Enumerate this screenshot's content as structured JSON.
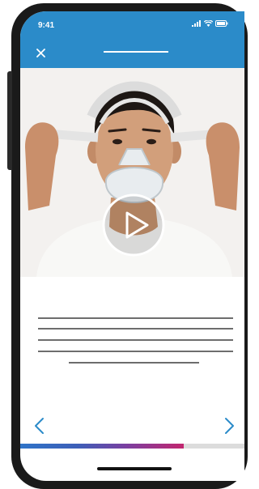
{
  "status_bar": {
    "time": "9:41"
  },
  "icons": {
    "close": "close-icon",
    "play": "play-icon",
    "prev": "chevron-left-icon",
    "next": "chevron-right-icon",
    "signal": "signal-icon",
    "wifi": "wifi-icon",
    "battery": "battery-icon"
  },
  "colors": {
    "topbar": "#2b8bc9",
    "progress_start": "#2f74c8",
    "progress_end": "#c2266f",
    "progress_track": "#dcdcdc"
  },
  "video": {
    "state": "paused"
  },
  "progress": {
    "fraction": 0.73
  }
}
